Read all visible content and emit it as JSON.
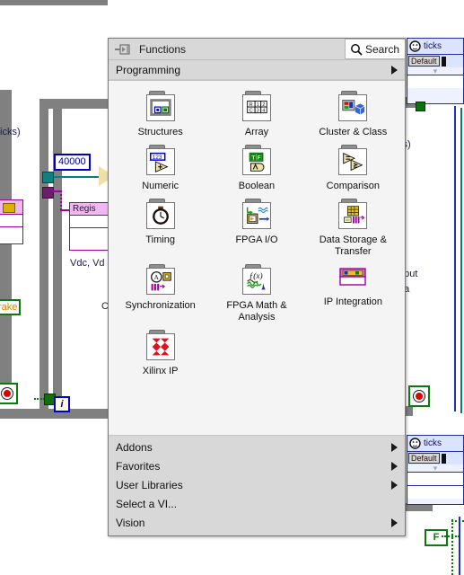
{
  "palette": {
    "title": "Functions",
    "pin_icon": "thumbtack-icon",
    "search_label": "Search",
    "search_icon": "magnifier-icon",
    "breadcrumb": "Programming",
    "items": [
      {
        "label": "Structures",
        "icon": "structures-folder-icon"
      },
      {
        "label": "Array",
        "icon": "array-folder-icon"
      },
      {
        "label": "Cluster & Class",
        "icon": "cluster-class-folder-icon"
      },
      {
        "label": "Numeric",
        "icon": "numeric-folder-icon"
      },
      {
        "label": "Boolean",
        "icon": "boolean-folder-icon"
      },
      {
        "label": "Comparison",
        "icon": "comparison-folder-icon"
      },
      {
        "label": "Timing",
        "icon": "timing-folder-icon"
      },
      {
        "label": "FPGA I/O",
        "icon": "fpga-io-folder-icon"
      },
      {
        "label": "Data Storage & Transfer",
        "icon": "data-storage-transfer-folder-icon"
      },
      {
        "label": "Synchronization",
        "icon": "synchronization-folder-icon"
      },
      {
        "label": "FPGA Math & Analysis",
        "icon": "fpga-math-analysis-folder-icon"
      },
      {
        "label": "IP Integration",
        "icon": "ip-integration-icon"
      },
      {
        "label": "Xilinx IP",
        "icon": "xilinx-ip-folder-icon"
      }
    ],
    "menu": [
      {
        "label": "Addons",
        "has_submenu": true
      },
      {
        "label": "Favorites",
        "has_submenu": true
      },
      {
        "label": "User Libraries",
        "has_submenu": true
      },
      {
        "label": "Select a VI...",
        "has_submenu": false
      },
      {
        "label": "Vision",
        "has_submenu": true
      }
    ]
  },
  "diagram": {
    "numeric_constant": "40000",
    "boolean_constant": "F",
    "iteration_terminal": "i",
    "brake_control": "rake",
    "labels": {
      "ticks_left": "icks)",
      "ticks_right": "cs)",
      "vdc": "Vdc, Vd",
      "output": "utput",
      "theta": "eta",
      "c_fragment": "C"
    },
    "register_node": "Regis",
    "ticks_nodes": [
      {
        "label": "ticks",
        "mode": "Default"
      },
      {
        "label": "ticks",
        "mode": "Default"
      }
    ],
    "colors": {
      "structure_border": "#808080",
      "wire_teal": "#008080",
      "wire_purple": "#a000a0",
      "wire_green": "#0a7a0a",
      "vi_header": "#f0b8f0",
      "constant_blue": "#0000cc"
    }
  }
}
